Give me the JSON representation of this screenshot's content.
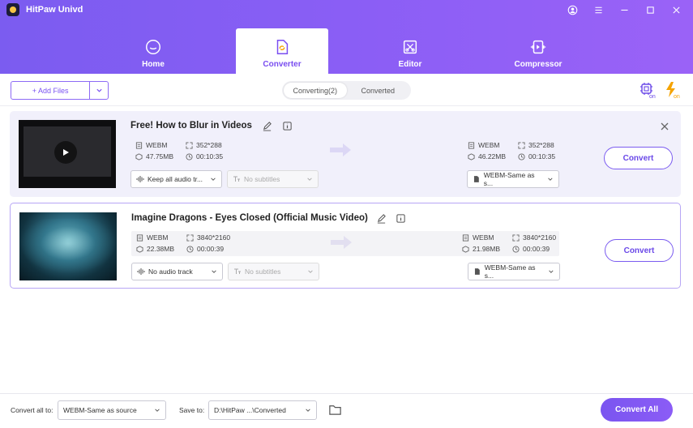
{
  "app": {
    "title": "HitPaw Univd"
  },
  "colors": {
    "accent": "#7b5cf0",
    "accent_text": "#6a48e8",
    "card_bg": "#f1f0fb",
    "bolt": "#f5a300"
  },
  "window_controls": [
    "user-icon",
    "minimize-icon",
    "maximize-icon",
    "close-icon"
  ],
  "nav": {
    "tabs": [
      {
        "label": "Home",
        "icon": "home-icon",
        "active": false
      },
      {
        "label": "Converter",
        "icon": "converter-icon",
        "active": true
      },
      {
        "label": "Editor",
        "icon": "editor-icon",
        "active": false
      },
      {
        "label": "Compressor",
        "icon": "compressor-icon",
        "active": false
      }
    ]
  },
  "toolbar": {
    "add_files_label": "+ Add Files",
    "switch": [
      {
        "label": "Converting(2)",
        "active": true
      },
      {
        "label": "Converted",
        "active": false
      }
    ],
    "hw_accel_badge": "on",
    "lightning_badge": "on"
  },
  "files": [
    {
      "title": "Free! How to Blur in Videos",
      "source": {
        "format": "WEBM",
        "resolution": "352*288",
        "size": "47.75MB",
        "duration": "00:10:35"
      },
      "target": {
        "format": "WEBM",
        "resolution": "352*288",
        "size": "46.22MB",
        "duration": "00:10:35"
      },
      "audio": "Keep all audio tr...",
      "subtitles": "No subtitles",
      "output": "WEBM-Same as s...",
      "convert_label": "Convert"
    },
    {
      "title": "Imagine Dragons - Eyes Closed (Official Music Video)",
      "source": {
        "format": "WEBM",
        "resolution": "3840*2160",
        "size": "22.38MB",
        "duration": "00:00:39"
      },
      "target": {
        "format": "WEBM",
        "resolution": "3840*2160",
        "size": "21.98MB",
        "duration": "00:00:39"
      },
      "audio": "No audio track",
      "subtitles": "No subtitles",
      "output": "WEBM-Same as s...",
      "convert_label": "Convert"
    }
  ],
  "footer": {
    "convert_all_to_label": "Convert all to:",
    "convert_all_to_value": "WEBM-Same as source",
    "save_to_label": "Save to:",
    "save_to_value": "D:\\HitPaw ...\\Converted",
    "convert_all_label": "Convert All"
  }
}
